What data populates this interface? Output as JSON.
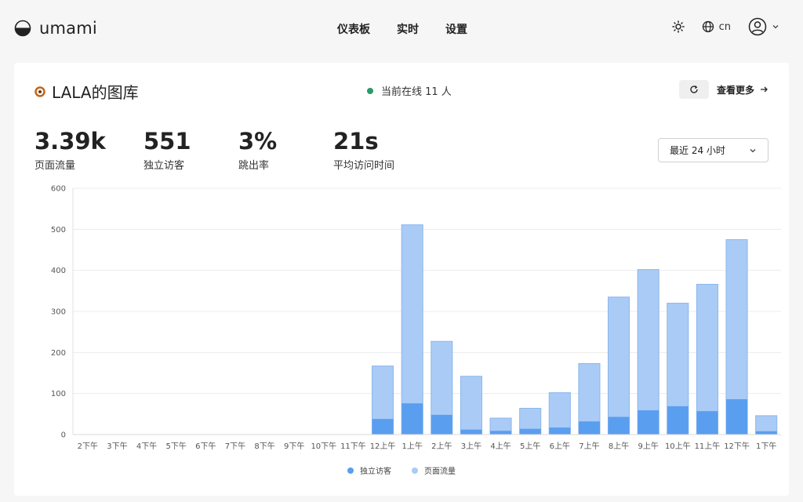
{
  "brand": {
    "name": "umami"
  },
  "nav": {
    "items": [
      "仪表板",
      "实时",
      "设置"
    ]
  },
  "tools": {
    "theme_icon": "sun-icon",
    "lang_icon": "globe-icon",
    "lang": "cn",
    "profile_icon": "user-circle-icon"
  },
  "site": {
    "name": "LALA的图库",
    "online_text": "当前在线 11 人",
    "more_label": "查看更多"
  },
  "metrics": [
    {
      "value": "3.39k",
      "label": "页面流量"
    },
    {
      "value": "551",
      "label": "独立访客"
    },
    {
      "value": "3%",
      "label": "跳出率"
    },
    {
      "value": "21s",
      "label": "平均访问时间"
    }
  ],
  "range": {
    "selected": "最近 24 小时"
  },
  "colors": {
    "accent_green": "#2b9a66",
    "visitors": "#5a9ef0",
    "pageviews": "#a9cbf5",
    "pageviews_stroke": "#8db8ee"
  },
  "chart_data": {
    "type": "bar",
    "stacked": true,
    "categories": [
      "2下午",
      "3下午",
      "4下午",
      "5下午",
      "6下午",
      "7下午",
      "8下午",
      "9下午",
      "10下午",
      "11下午",
      "12上午",
      "1上午",
      "2上午",
      "3上午",
      "4上午",
      "5上午",
      "6上午",
      "7上午",
      "8上午",
      "9上午",
      "10上午",
      "11上午",
      "12下午",
      "1下午"
    ],
    "series": [
      {
        "name": "独立访客",
        "values": [
          0,
          0,
          0,
          0,
          0,
          0,
          0,
          0,
          0,
          0,
          38,
          76,
          48,
          12,
          9,
          14,
          17,
          32,
          43,
          59,
          69,
          57,
          86,
          8
        ]
      },
      {
        "name": "页面流量",
        "values": [
          0,
          0,
          0,
          0,
          0,
          0,
          0,
          0,
          0,
          0,
          167,
          511,
          227,
          142,
          40,
          64,
          102,
          173,
          335,
          402,
          320,
          366,
          475,
          46
        ]
      }
    ],
    "yticks": [
      0,
      100,
      200,
      300,
      400,
      500,
      600
    ],
    "ylim": [
      0,
      600
    ],
    "grid": true,
    "legend": "bottom-center"
  }
}
